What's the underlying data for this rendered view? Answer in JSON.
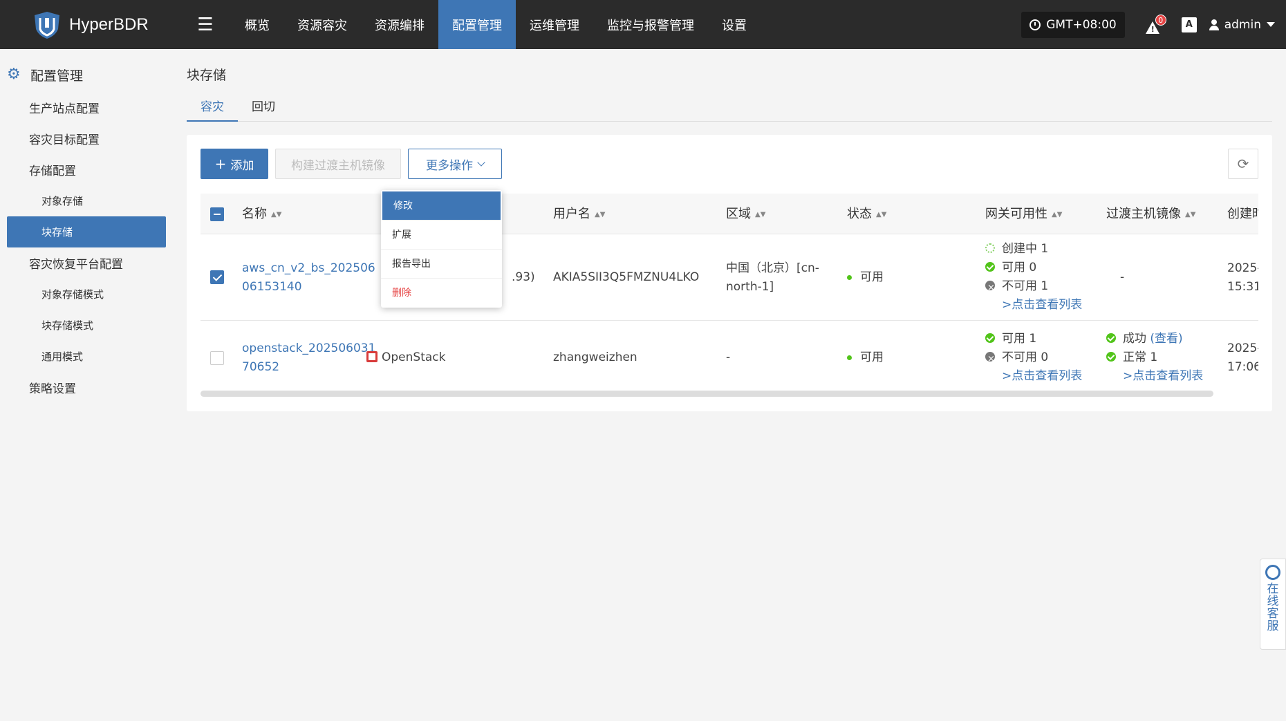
{
  "app": {
    "name": "HyperBDR"
  },
  "nav": [
    {
      "label": "概览"
    },
    {
      "label": "资源容灾"
    },
    {
      "label": "资源编排"
    },
    {
      "label": "配置管理"
    },
    {
      "label": "运维管理"
    },
    {
      "label": "监控与报警管理"
    },
    {
      "label": "设置"
    }
  ],
  "topright": {
    "timezone": "GMT+08:00",
    "alert_count": "0",
    "lang_label": "A",
    "user": "admin"
  },
  "sidebar": {
    "title": "配置管理",
    "items": [
      {
        "label": "生产站点配置"
      },
      {
        "label": "容灾目标配置"
      },
      {
        "label": "存储配置"
      },
      {
        "label": "对象存储"
      },
      {
        "label": "块存储"
      },
      {
        "label": "容灾恢复平台配置"
      },
      {
        "label": "对象存储模式"
      },
      {
        "label": "块存储模式"
      },
      {
        "label": "通用模式"
      },
      {
        "label": "策略设置"
      }
    ]
  },
  "page": {
    "title": "块存储"
  },
  "tabs": [
    {
      "label": "容灾"
    },
    {
      "label": "回切"
    }
  ],
  "toolbar": {
    "add": "添加",
    "build": "构建过渡主机镜像",
    "more": "更多操作"
  },
  "dropdown": {
    "items": [
      "修改",
      "扩展",
      "报告导出",
      "删除"
    ]
  },
  "table": {
    "headers": [
      "名称",
      "用户名",
      "区域",
      "状态",
      "网关可用性",
      "过渡主机镜像",
      "创建时"
    ],
    "rows": [
      {
        "name_line1": "aws_cn_v2_bs_202506",
        "name_line2": "06153140",
        "platform_partial": ".93)",
        "username": "AKIA5SII3Q5FMZNU4LKO",
        "region_line1": "中国（北京）[cn-",
        "region_line2": "north-1]",
        "status": "可用",
        "gateway": [
          "创建中 1",
          "可用 0",
          "不可用 1"
        ],
        "gateway_link": ">点击查看列表",
        "image": "-",
        "created_line1": "2025-",
        "created_line2": "15:31:"
      },
      {
        "name_line1": "openstack_202506031",
        "name_line2": "70652",
        "platform": "OpenStack",
        "username": "zhangweizhen",
        "region": "-",
        "status": "可用",
        "gateway": [
          "可用 1",
          "不可用 0"
        ],
        "gateway_link": ">点击查看列表",
        "image_status": "成功",
        "image_view": "(查看)",
        "image_normal": "正常 1",
        "image_link": ">点击查看列表",
        "created_line1": "2025-",
        "created_line2": "17:06:"
      }
    ]
  },
  "service": {
    "label": "在线客服"
  },
  "colors": {
    "accent": "#3e76b5",
    "topbar": "#2b2b2b",
    "success": "#52c41a",
    "danger": "#e64545"
  }
}
